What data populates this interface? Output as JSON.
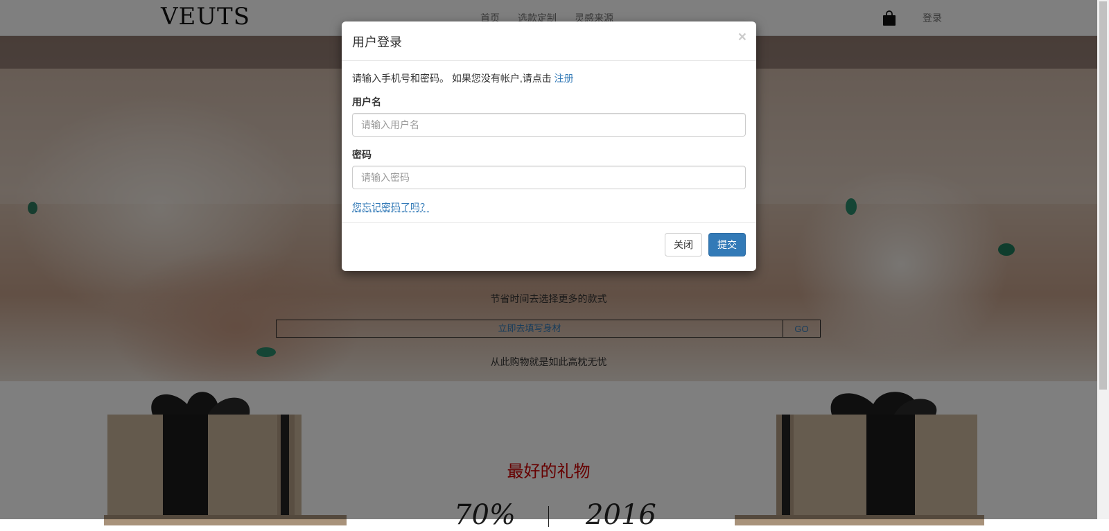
{
  "navbar": {
    "logo": "VEUTS",
    "links": [
      "首页",
      "选款定制",
      "灵感来源"
    ],
    "cart_icon": "shopping-bag-icon",
    "login": "登录"
  },
  "hero": {
    "subtitle_top": "节省时间去选择更多的款式",
    "input_placeholder": "立即去填写身材",
    "go_label": "GO",
    "subtitle_bottom": "从此购物就是如此高枕无忧"
  },
  "gifts": {
    "title": "最好的礼物",
    "stat_left": "70%",
    "stat_right": "2016"
  },
  "modal": {
    "title": "用户登录",
    "close_symbol": "×",
    "intro_text": "请输入手机号和密码。 如果您没有帐户,请点击",
    "register_link": "注册",
    "username_label": "用户名",
    "username_placeholder": "请输入用户名",
    "password_label": "密码",
    "password_placeholder": "请输入密码",
    "forgot_link": "您忘记密码了吗？",
    "close_button": "关闭",
    "submit_button": "提交"
  },
  "colors": {
    "accent": "#337ab7",
    "gift_title": "#cc0000",
    "backdrop": "rgba(0,0,0,0.5)"
  }
}
